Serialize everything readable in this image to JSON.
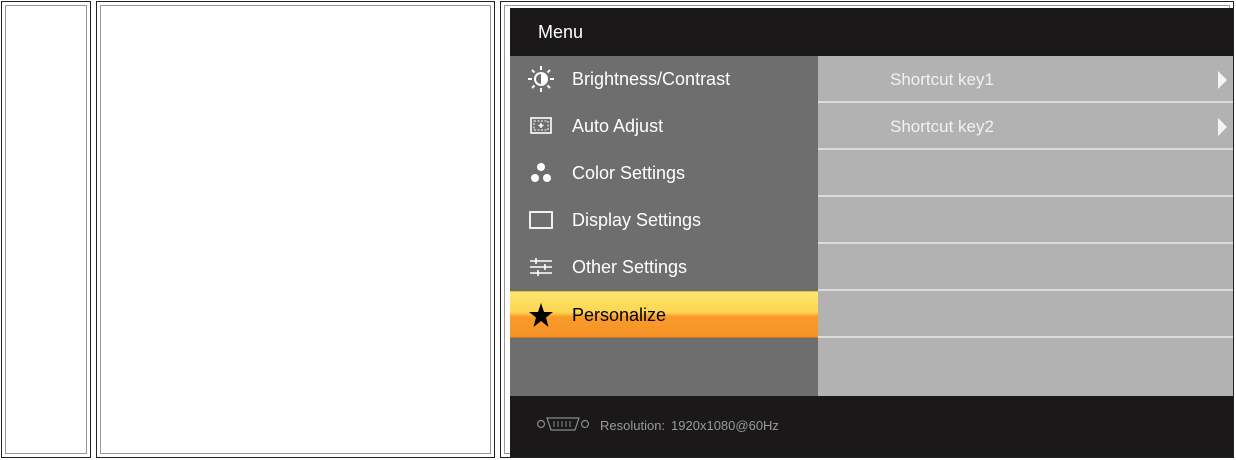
{
  "menu": {
    "title": "Menu",
    "items": [
      {
        "label": "Brightness/Contrast",
        "icon": "brightness-icon"
      },
      {
        "label": "Auto Adjust",
        "icon": "auto-adjust-icon"
      },
      {
        "label": "Color Settings",
        "icon": "color-settings-icon"
      },
      {
        "label": "Display Settings",
        "icon": "display-settings-icon"
      },
      {
        "label": "Other Settings",
        "icon": "other-settings-icon"
      },
      {
        "label": "Personalize",
        "icon": "star-icon",
        "selected": true
      }
    ]
  },
  "submenu": {
    "items": [
      {
        "label": "Shortcut key1"
      },
      {
        "label": "Shortcut key2"
      }
    ]
  },
  "footer": {
    "resolution_label": "Resolution:",
    "resolution_value": "1920x1080@60Hz"
  },
  "colors": {
    "menu_bg": "#6e6e6e",
    "submenu_bg": "#b2b2b2",
    "header_bg": "#1a1818",
    "selected_top": "#fde66f",
    "selected_bottom": "#f59226"
  }
}
